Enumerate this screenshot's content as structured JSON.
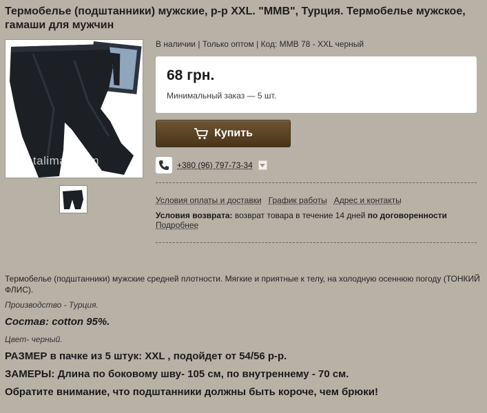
{
  "product": {
    "title": "Термобелье (подштанники) мужские, р-р XXL. \"MMB\", Турция. Термобелье мужское, гамаши для мужчин",
    "availability": "В наличии",
    "wholesale": "Только оптом",
    "code": "Код: MMB 78 - XXL черный",
    "price": "68 грн.",
    "min_order": "Минимальный заказ — 5 шт.",
    "buy_label": "Купить",
    "watermark": "natalimax.com",
    "separator": "|"
  },
  "contact": {
    "phone": "+380 (96) 797-73-34"
  },
  "info_links": {
    "payment_delivery": "Условия оплаты и доставки",
    "schedule": "График работы",
    "address": "Адрес и контакты",
    "return_label": "Условия возврата:",
    "return_text": "возврат товара в течение 14 дней",
    "return_negotiable": "по договоренности",
    "more": "Подробнее"
  },
  "description": {
    "intro": "Термобелье (подштанники) мужские средней плотности. Мягкие и приятные к телу, на холодную осеннюю погоду (ТОНКИЙ ФЛИС).",
    "production": "Производство - Турция.",
    "composition": "Состав: cotton 95%.",
    "color": "Цвет- черный.",
    "size": "РАЗМЕР в пачке из 5 штук: XXL , подойдет от  54/56 р-р.",
    "measurements": "ЗАМЕРЫ: Длина по боковому шву- 105 см, по внутреннему - 70 см.",
    "notice": "Обратите внимание, что подштанники должны быть короче, чем брюки!"
  },
  "colors": {
    "page_bg": "#b8b2a6",
    "button_top": "#6e5432",
    "button_bottom": "#4a3419",
    "dashed_line": "#6b6350"
  },
  "icons": {
    "cart": "cart-icon",
    "phone": "phone-icon",
    "dropdown": "chevron-down-icon"
  }
}
